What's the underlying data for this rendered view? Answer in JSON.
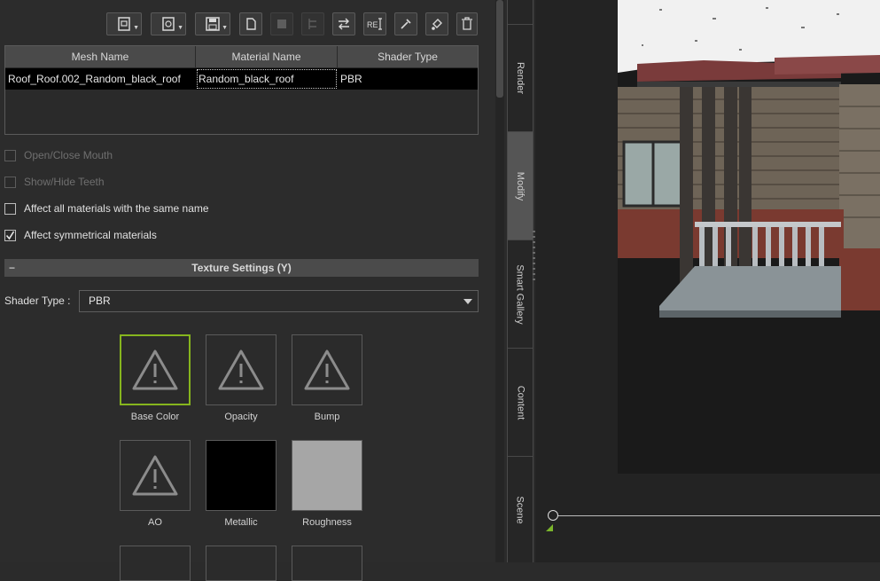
{
  "toolbar": {
    "buttons": [
      {
        "icon": "load-material-icon",
        "dropdown": true
      },
      {
        "icon": "load-shader-icon",
        "dropdown": true
      },
      {
        "icon": "save-icon",
        "dropdown": true
      },
      {
        "icon": "copy-icon",
        "dropdown": false
      },
      {
        "icon": "paste-icon",
        "dropdown": false,
        "disabled": true
      },
      {
        "icon": "hierarchy-icon",
        "dropdown": false,
        "disabled": true
      },
      {
        "icon": "swap-icon",
        "dropdown": false
      },
      {
        "icon": "rename-icon",
        "dropdown": false,
        "label": "RE"
      },
      {
        "icon": "eyedropper-icon",
        "dropdown": false
      },
      {
        "icon": "paint-bucket-icon",
        "dropdown": false
      },
      {
        "icon": "trash-icon",
        "dropdown": false
      }
    ]
  },
  "mesh_table": {
    "columns": [
      "Mesh Name",
      "Material Name",
      "Shader Type"
    ],
    "rows": [
      [
        "Roof_Roof.002_Random_black_roof",
        "Random_black_roof",
        "PBR"
      ]
    ]
  },
  "options": {
    "open_close_mouth": {
      "label": "Open/Close Mouth",
      "checked": false,
      "enabled": false
    },
    "show_hide_teeth": {
      "label": "Show/Hide Teeth",
      "checked": false,
      "enabled": false
    },
    "affect_same_name": {
      "label": "Affect all materials with the same name",
      "checked": false,
      "enabled": true
    },
    "affect_symmetrical": {
      "label": "Affect symmetrical materials",
      "checked": true,
      "enabled": true
    }
  },
  "texture_settings": {
    "collapse": "−",
    "title": "Texture Settings  (Y)",
    "shader_label": "Shader Type :",
    "shader_value": "PBR",
    "slots": [
      {
        "label": "Base Color",
        "state": "missing",
        "selected": true
      },
      {
        "label": "Opacity",
        "state": "missing"
      },
      {
        "label": "Bump",
        "state": "missing"
      },
      {
        "label": "AO",
        "state": "missing"
      },
      {
        "label": "Metallic",
        "state": "color",
        "color": "#000000"
      },
      {
        "label": "Roughness",
        "state": "color",
        "color": "#a6a6a6"
      }
    ]
  },
  "side_tabs": [
    {
      "label": "Render",
      "active": false
    },
    {
      "label": "Modify",
      "active": true
    },
    {
      "label": "Smart Gallery",
      "active": false
    },
    {
      "label": "Content",
      "active": false
    },
    {
      "label": "Scene",
      "active": false
    }
  ],
  "colors": {
    "selection": "#86b51e",
    "timeline_marker": "#7bb52b"
  }
}
